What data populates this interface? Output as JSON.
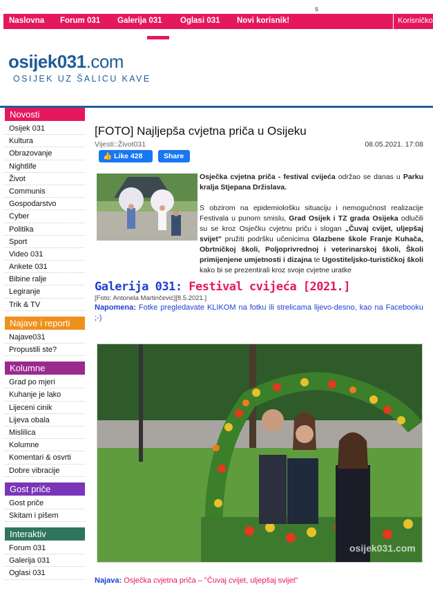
{
  "top_char": "s",
  "nav": {
    "items": [
      "Naslovna",
      "Forum 031",
      "Galerija 031",
      "Oglasi 031",
      "Novi korisnik!"
    ],
    "login": "Korisničko"
  },
  "header": {
    "logo_a": "osi",
    "logo_b": "jek031",
    "logo_c": ".com",
    "tagline": "OSIJEK UZ ŠALICU KAVE"
  },
  "sidebar": {
    "sections": [
      {
        "title": "Novosti",
        "color": "#e5185b",
        "items": [
          "Osijek 031",
          "Kultura",
          "Obrazovanje",
          "Nightlife",
          "Život",
          "Communis",
          "Gospodarstvo",
          "Cyber",
          "Politika",
          "Sport",
          "Video 031",
          "Ankete 031",
          "Bibine ralje",
          "Legiranje",
          "Trik & TV"
        ]
      },
      {
        "title": "Najave i reporti",
        "color": "#f0901c",
        "items": [
          "Najave031",
          "Propustili ste?"
        ]
      },
      {
        "title": "Kolumne",
        "color": "#9b2a8f",
        "items": [
          "Grad po mjeri",
          "Kuhanje je lako",
          "Lijeceni cinik",
          "Lijeva obala",
          "Mislilica",
          "Kolumne",
          "Komentari & osvrti",
          "Dobre vibracije"
        ]
      },
      {
        "title": "Gost priče",
        "color": "#7a35b8",
        "items": [
          "Gost priče",
          "Skitam i pišem"
        ]
      },
      {
        "title": "Interaktiv",
        "color": "#2f7560",
        "items": [
          "Forum 031",
          "Galerija 031",
          "Oglasi 031"
        ]
      }
    ]
  },
  "article": {
    "title": "[FOTO] Najljepša cvjetna priča u Osijeku",
    "category": "Vijesti::Život031",
    "date": "08.05.2021. 17:08",
    "like_label": "Like 428",
    "share_label": "Share",
    "p1_b1": "Osječka cvjetna priča - festival cvijeća",
    "p1_t1": " održao se danas u ",
    "p1_b2": "Parku kralja Stjepana Držislava.",
    "p2_t1": "S obzirom na epidemiološku situaciju i nemogućnost realizacije Festivala u punom smislu, ",
    "p2_b1": "Grad Osijek i TZ grada Osijeka",
    "p2_t2": " odlučili su se kroz Osječku cvjetnu priču i slogan ",
    "p2_b2": "„Čuvaj cvijet, uljepšaj svijet\"",
    "p2_t3": " pružiti podršku učenicima ",
    "p2_b3": "Glazbene škole Franje Kuhača, Obrtničkoj školi, Poljoprivrednoj i veterinarskoj školi, Školi primijenjene umjetnosti i dizajna",
    "p2_t4": " te ",
    "p2_b4": "Ugostiteljsko-turističkoj školi",
    "p2_t5": " kako bi se prezentirali kroz svoje cvjetne uratke"
  },
  "gallery": {
    "title_a": "Galerija 031:",
    "title_b": " Festival cvijeća [2021.]",
    "credit": "[Foto: Antonela Martinčević][8.5.2021.]",
    "note_label": "Napomena:",
    "note_text": " Fotke pregledavate KLIKOM na fotku ili strelicama lijevo-desno, kao na Facebooku ;-)",
    "watermark": "osijek031.com"
  },
  "najava": {
    "label": "Najava:",
    "text": " Osječka cvjetna priča – \"Čuvaj cvijet, uljepšaj svijet\""
  }
}
